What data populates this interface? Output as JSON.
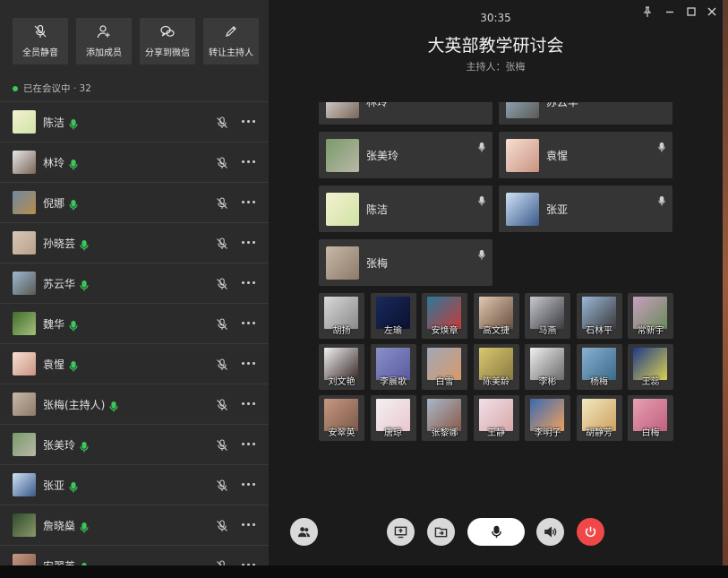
{
  "toolbar": {
    "actions": [
      {
        "label": "全员静音",
        "icon": "mute-all-icon"
      },
      {
        "label": "添加成员",
        "icon": "add-member-icon"
      },
      {
        "label": "分享到微信",
        "icon": "wechat-share-icon"
      },
      {
        "label": "转让主持人",
        "icon": "transfer-host-icon"
      }
    ]
  },
  "sidebar": {
    "in_meeting": "已在会议中 · 32",
    "participants": [
      {
        "name": "陈洁",
        "colors": [
          "#f4f1d0",
          "#cfe3a6"
        ]
      },
      {
        "name": "林玲",
        "colors": [
          "#e7e7e7",
          "#7a6658"
        ]
      },
      {
        "name": "倪娜",
        "colors": [
          "#6e8aa0",
          "#b88c4e"
        ]
      },
      {
        "name": "孙晓芸",
        "colors": [
          "#d6c7b8",
          "#b9a189"
        ]
      },
      {
        "name": "苏云华",
        "colors": [
          "#9db8d0",
          "#5a5a55"
        ]
      },
      {
        "name": "魏华",
        "colors": [
          "#3f6d2e",
          "#a7c07a"
        ]
      },
      {
        "name": "袁惺",
        "colors": [
          "#f6e0d2",
          "#c99382"
        ]
      },
      {
        "name": "张梅(主持人)",
        "colors": [
          "#c8b8a8",
          "#8c7a6a"
        ]
      },
      {
        "name": "张美玲",
        "colors": [
          "#7a9a6a",
          "#b8b8a8"
        ]
      },
      {
        "name": "张亚",
        "colors": [
          "#cfe1f4",
          "#3a5a8a"
        ]
      },
      {
        "name": "詹晓燊",
        "colors": [
          "#2f4a2c",
          "#8a9a6a"
        ]
      },
      {
        "name": "安翠英",
        "colors": [
          "#c89880",
          "#7a5a4a"
        ]
      }
    ]
  },
  "meeting": {
    "timer": "30:35",
    "title": "大英部教学研讨会",
    "host": "主持人：张梅"
  },
  "video_tiles": [
    {
      "name": "林玲",
      "colors": [
        "#e7e7e7",
        "#7a6658"
      ]
    },
    {
      "name": "苏云华",
      "colors": [
        "#9db8d0",
        "#5a5a55"
      ]
    },
    {
      "name": "张美玲",
      "colors": [
        "#7a9a6a",
        "#b8b8a8"
      ]
    },
    {
      "name": "袁惺",
      "colors": [
        "#f6e0d2",
        "#c99382"
      ]
    },
    {
      "name": "陈洁",
      "colors": [
        "#f4f1d0",
        "#cfe3a6"
      ]
    },
    {
      "name": "张亚",
      "colors": [
        "#cfe1f4",
        "#3a5a8a"
      ]
    },
    {
      "name": "张梅",
      "colors": [
        "#c8b8a8",
        "#8c7a6a"
      ]
    }
  ],
  "grid_tiles": [
    {
      "name": "胡扬",
      "colors": [
        "#d8d8d8",
        "#8a8a8a"
      ]
    },
    {
      "name": "左瑜",
      "colors": [
        "#1a2a5a",
        "#0a1030"
      ]
    },
    {
      "name": "安焕章",
      "colors": [
        "#2a7a9a",
        "#c83a3a"
      ]
    },
    {
      "name": "高文捷",
      "colors": [
        "#e0c8b0",
        "#6a5040"
      ]
    },
    {
      "name": "马燕",
      "colors": [
        "#c8c8d0",
        "#3a3a40"
      ]
    },
    {
      "name": "石林平",
      "colors": [
        "#9ab8d8",
        "#3a3a3a"
      ]
    },
    {
      "name": "常新宇",
      "colors": [
        "#c8a0c0",
        "#6a8a5a"
      ]
    },
    {
      "name": "刘文艳",
      "colors": [
        "#f0f0f0",
        "#3a2a2a"
      ]
    },
    {
      "name": "李晨歌",
      "colors": [
        "#8a90c8",
        "#5a5aa0"
      ]
    },
    {
      "name": "白雪",
      "colors": [
        "#a0a8b8",
        "#d89a6a"
      ]
    },
    {
      "name": "陈美龄",
      "colors": [
        "#d8c870",
        "#8a7a40"
      ]
    },
    {
      "name": "李彬",
      "colors": [
        "#f0f0f0",
        "#6a6a6a"
      ]
    },
    {
      "name": "杨梅",
      "colors": [
        "#8ab0d0",
        "#3a6a8a"
      ]
    },
    {
      "name": "王蕊",
      "colors": [
        "#203a8a",
        "#d8d050"
      ]
    },
    {
      "name": "安翠英",
      "colors": [
        "#c89880",
        "#7a5a4a"
      ]
    },
    {
      "name": "唐琼",
      "colors": [
        "#f4f0f0",
        "#e8c8d0"
      ]
    },
    {
      "name": "张黎娜",
      "colors": [
        "#a8b8c8",
        "#8a5a4a"
      ]
    },
    {
      "name": "王静",
      "colors": [
        "#f0e0e8",
        "#d8a8a8"
      ]
    },
    {
      "name": "李明子",
      "colors": [
        "#3a6ab0",
        "#f0a060"
      ]
    },
    {
      "name": "胡静芳",
      "colors": [
        "#f0e8c0",
        "#d0a060"
      ]
    },
    {
      "name": "白梅",
      "colors": [
        "#e8a0b0",
        "#c06080"
      ]
    }
  ],
  "controls": {
    "participants_icon": "participants-icon",
    "screen_share_icon": "screen-share-icon",
    "file_share_icon": "file-share-icon",
    "mic_icon": "microphone-icon",
    "speaker_icon": "speaker-icon",
    "hangup_icon": "power-icon",
    "hangup_color": "#f04848"
  }
}
